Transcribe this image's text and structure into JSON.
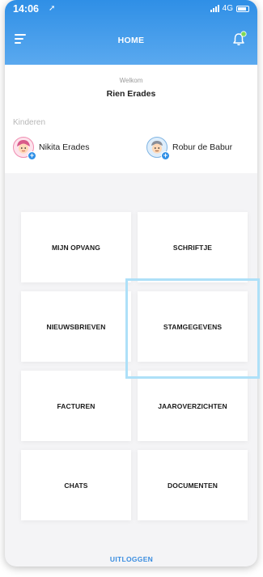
{
  "status_bar": {
    "time": "14:06",
    "network": "4G"
  },
  "header": {
    "title": "HOME",
    "menu_icon": "menu-icon",
    "notification_icon": "bell-icon",
    "accent": "#2f8fe6"
  },
  "welcome": {
    "greeting": "Welkom",
    "user_name": "Rien Erades"
  },
  "children": {
    "label": "Kinderen",
    "items": [
      {
        "name": "Nikita Erades",
        "icon": "child-avatar-girl"
      },
      {
        "name": "Robur de Babur",
        "icon": "child-avatar-boy"
      }
    ]
  },
  "menu": {
    "tiles": [
      {
        "label": "MIJN OPVANG"
      },
      {
        "label": "SCHRIFTJE"
      },
      {
        "label": "NIEUWSBRIEVEN"
      },
      {
        "label": "STAMGEGEVENS",
        "highlighted": true
      },
      {
        "label": "FACTUREN"
      },
      {
        "label": "JAAROVERZICHTEN"
      },
      {
        "label": "CHATS"
      },
      {
        "label": "DOCUMENTEN"
      }
    ]
  },
  "footer": {
    "logout_label": "UITLOGGEN",
    "highlight_color": "#aee0f8"
  }
}
